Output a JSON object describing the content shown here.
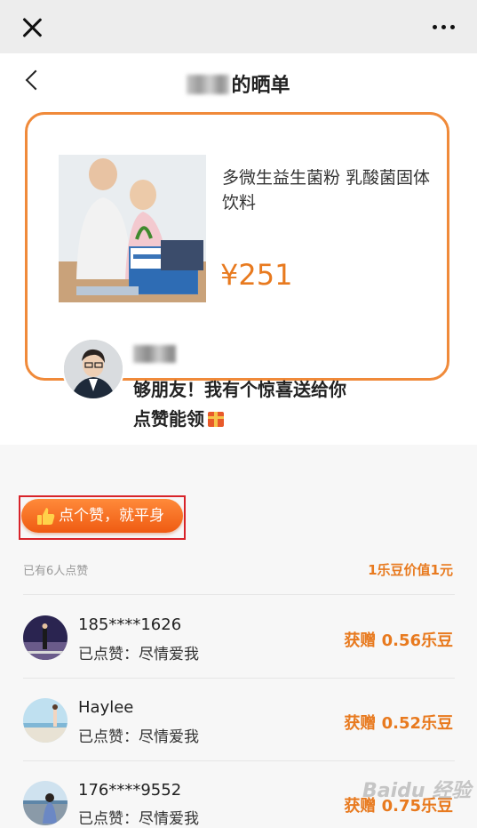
{
  "header": {
    "close_icon": "close-icon",
    "more_icon": "more-dots-icon",
    "back_icon": "chevron-left-icon",
    "title_suffix": "的晒单"
  },
  "product": {
    "name": "多微生益生菌粉 乳酸菌固体饮料",
    "price": "¥251"
  },
  "share": {
    "message_line1": "够朋友！我有个惊喜送给你",
    "message_line2": "点赞能领",
    "gift_icon": "gift-icon"
  },
  "like": {
    "button_label": "点个赞，就平身",
    "thumb_icon": "thumbs-up-icon",
    "liked_count": "已有6人点赞",
    "value_note": "1乐豆价值1元"
  },
  "likers": [
    {
      "name": "185****1626",
      "liked_text": "已点赞：尽情爱我",
      "reward": "获赠 0.56乐豆"
    },
    {
      "name": "Haylee",
      "liked_text": "已点赞：尽情爱我",
      "reward": "获赠 0.52乐豆"
    },
    {
      "name": "176****9552",
      "liked_text": "已点赞：尽情爱我",
      "reward": "获赠 0.75乐豆"
    }
  ],
  "watermark": "Baidu 经验",
  "colors": {
    "accent": "#e87a1f",
    "card_border": "#f08a3a",
    "highlight_box": "#d8232a"
  }
}
